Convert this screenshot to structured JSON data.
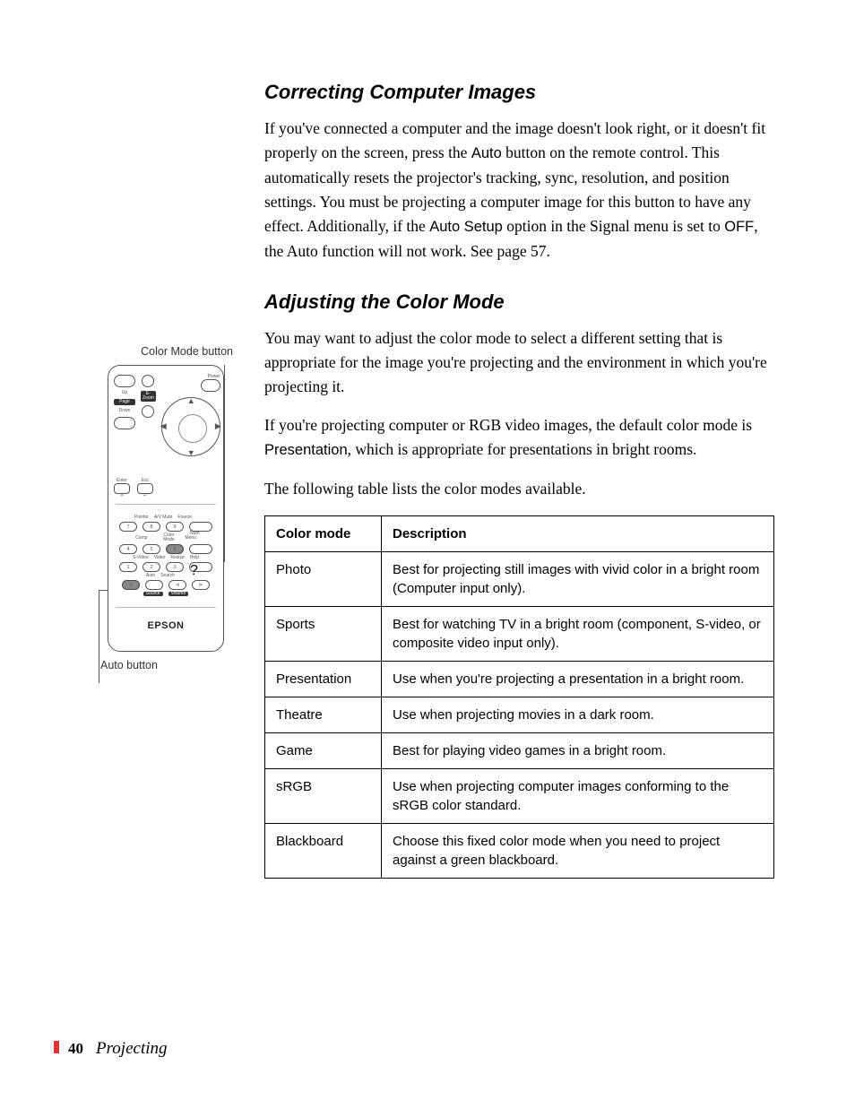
{
  "sections": {
    "s1_title": "Correcting Computer Images",
    "s1_p1a": "If you've connected a computer and the image doesn't look right, or it doesn't fit properly on the screen, press the ",
    "s1_auto1": "Auto",
    "s1_p1b": " button on the remote control. This automatically resets the projector's tracking, sync, resolution, and position settings. You must be projecting a computer image for this button to have any effect. Additionally, if the ",
    "s1_autosetup": "Auto Setup",
    "s1_p1c": " option in the Signal menu is set to ",
    "s1_off": "OFF",
    "s1_p1d": ", the Auto function will not work. See page 57.",
    "s2_title": "Adjusting the Color Mode",
    "s2_p1": "You may want to adjust the color mode to select a different setting that is appropriate for the image you're projecting and the environment in which you're projecting it.",
    "s2_p2a": "If you're projecting computer or RGB video images, the default color mode is ",
    "s2_presentation": "Presentation",
    "s2_p2b": ", which is appropriate for presentations in bright rooms.",
    "s2_p3": "The following table lists the color modes available."
  },
  "table": {
    "h1": "Color mode",
    "h2": "Description",
    "rows": [
      {
        "mode": "Photo",
        "desc": "Best for projecting still images with vivid color in a bright room (Computer input only)."
      },
      {
        "mode": "Sports",
        "desc": "Best for watching TV in a bright room (component, S-video, or composite video input only)."
      },
      {
        "mode": "Presentation",
        "desc": "Use when you're projecting a presentation in a bright room."
      },
      {
        "mode": "Theatre",
        "desc": "Use when projecting movies in a dark room."
      },
      {
        "mode": "Game",
        "desc": "Best for playing video games in a bright room."
      },
      {
        "mode": "sRGB",
        "desc": "Use when projecting computer images conforming to the sRGB color standard."
      },
      {
        "mode": "Blackboard",
        "desc": "Choose this fixed color mode when you need to project against a green blackboard."
      }
    ]
  },
  "sidebar": {
    "caption_top": "Color Mode button",
    "caption_bottom": "Auto button",
    "brand": "EPSON",
    "btn_labels": {
      "power": "Power",
      "up": "Up",
      "down": "Down",
      "page": "Page",
      "ezoom": "E-Zoom",
      "enter": "Enter",
      "esc": "Esc",
      "pointer": "Pointer",
      "avmute": "A/V Mute",
      "freeze": "Freeze",
      "num": "Num",
      "comp": "Comp",
      "colormode": "Color Mode",
      "menu": "Menu",
      "svideo": "S-Video",
      "video": "Video",
      "resize": "Resize",
      "help": "Help",
      "auto": "Auto",
      "search": "Search",
      "source": "Source",
      "volume": "Volume"
    }
  },
  "footer": {
    "page": "40",
    "chapter": "Projecting"
  }
}
